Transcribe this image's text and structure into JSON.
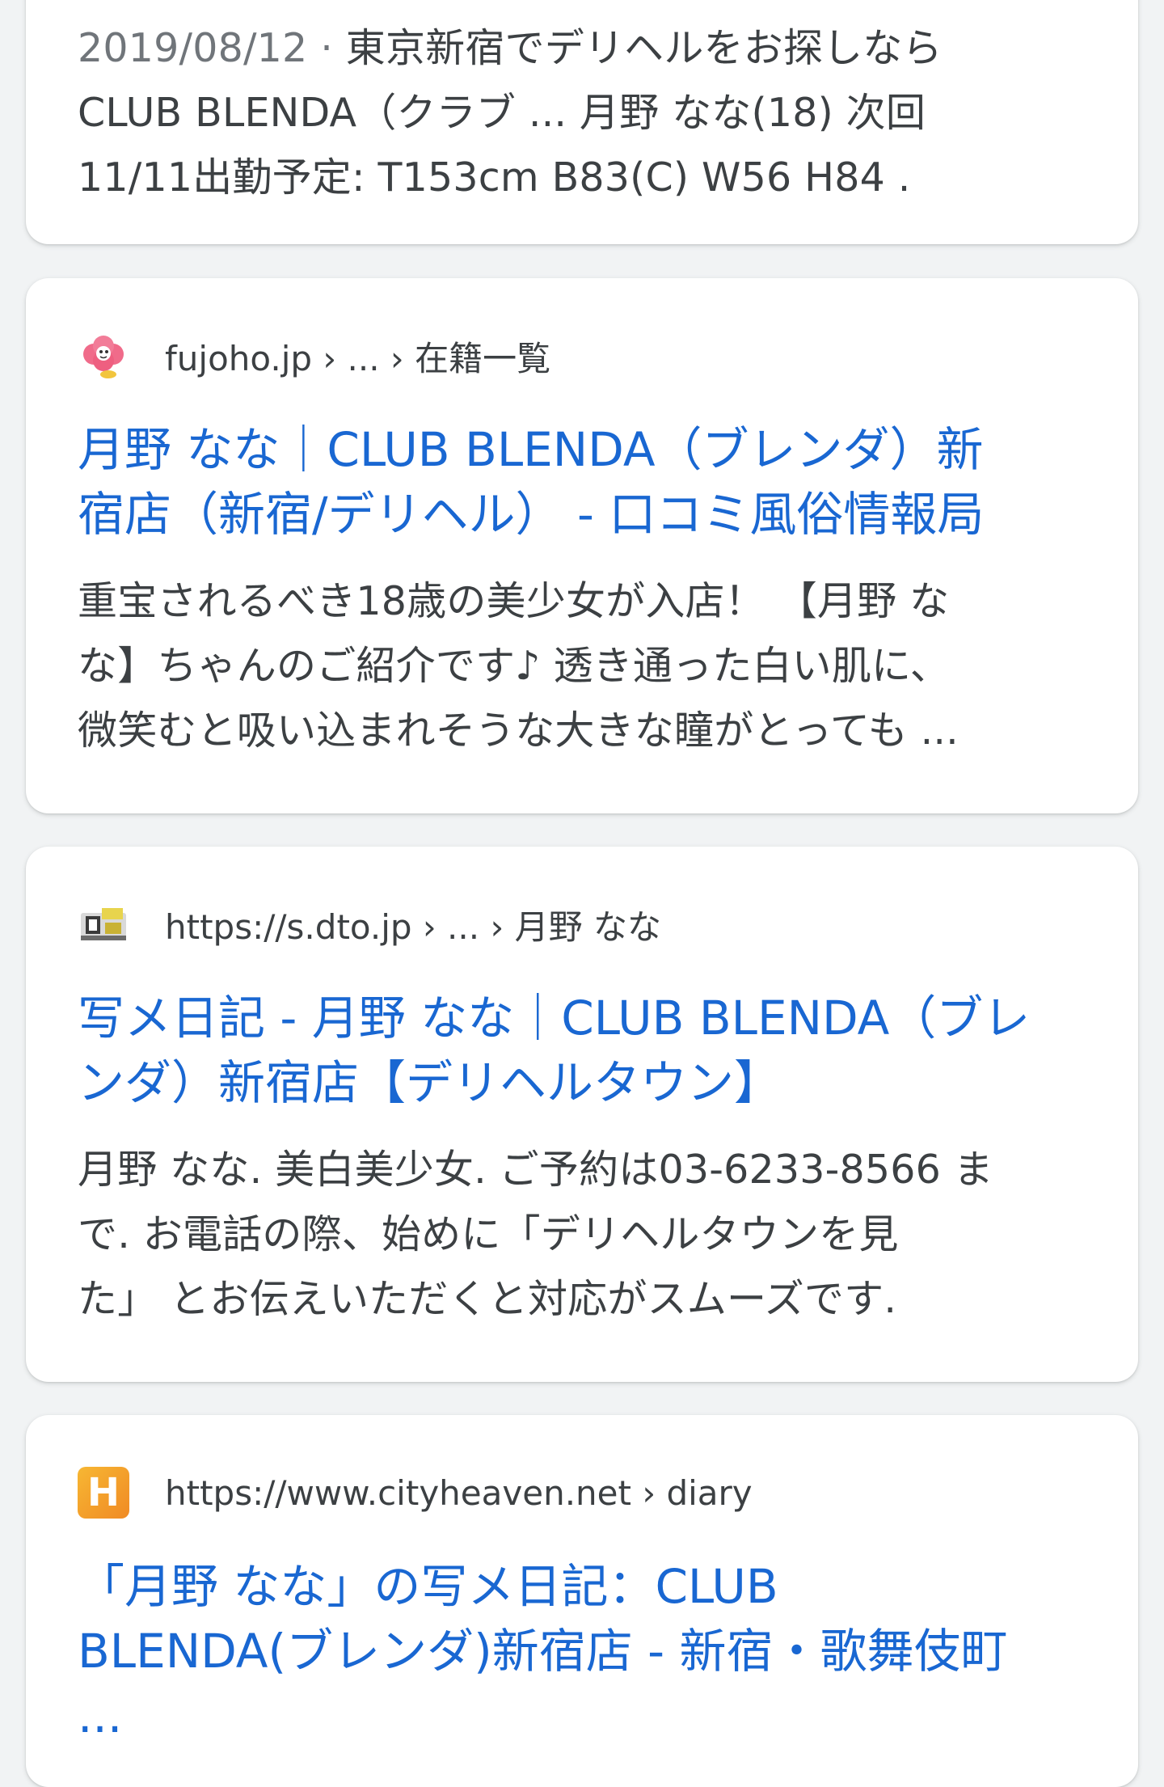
{
  "results": [
    {
      "date": "2019/08/12 · ",
      "snippet_lines": [
        "東京新宿でデリヘルをお探しなら",
        "CLUB BLENDA（クラブ ... 月野 なな(18) 次回",
        "11/11出勤予定: T153cm B83(C) W56 H84 ."
      ]
    },
    {
      "favicon": "fujoho-icon",
      "source": "fujoho.jp › ... › 在籍一覧",
      "title_lines": [
        "月野 なな｜CLUB BLENDA（ブレンダ）新",
        "宿店（新宿/デリヘル） - 口コミ風俗情報局"
      ],
      "snippet_lines": [
        "重宝されるべき18歳の美少女が入店！ 【月野 な",
        "な】ちゃんのご紹介です♪ 透き通った白い肌に、",
        "微笑むと吸い込まれそうな大きな瞳がとっても ..."
      ]
    },
    {
      "favicon": "dto-icon",
      "source": "https://s.dto.jp › ... › 月野 なな",
      "title_lines": [
        "写メ日記 - 月野 なな｜CLUB BLENDA（ブレ",
        "ンダ）新宿店【デリヘルタウン】"
      ],
      "snippet_lines": [
        "月野 なな. 美白美少女. ご予約は03-6233-8566 ま",
        "で. お電話の際、始めに「デリヘルタウンを見",
        "た」 とお伝えいただくと対応がスムーズです."
      ]
    },
    {
      "favicon": "cityheaven-icon",
      "favicon_letter": "H",
      "source": "https://www.cityheaven.net › diary",
      "title_lines": [
        "「月野 なな」の写メ日記：CLUB",
        "BLENDA(ブレンダ)新宿店 - 新宿・歌舞伎町",
        "..."
      ]
    }
  ],
  "colors": {
    "title_link": "#1967d2",
    "snippet_text": "#3c4043",
    "date_text": "#70757a",
    "page_background": "#f1f3f4",
    "cityheaven_orange": "#f08a24"
  }
}
